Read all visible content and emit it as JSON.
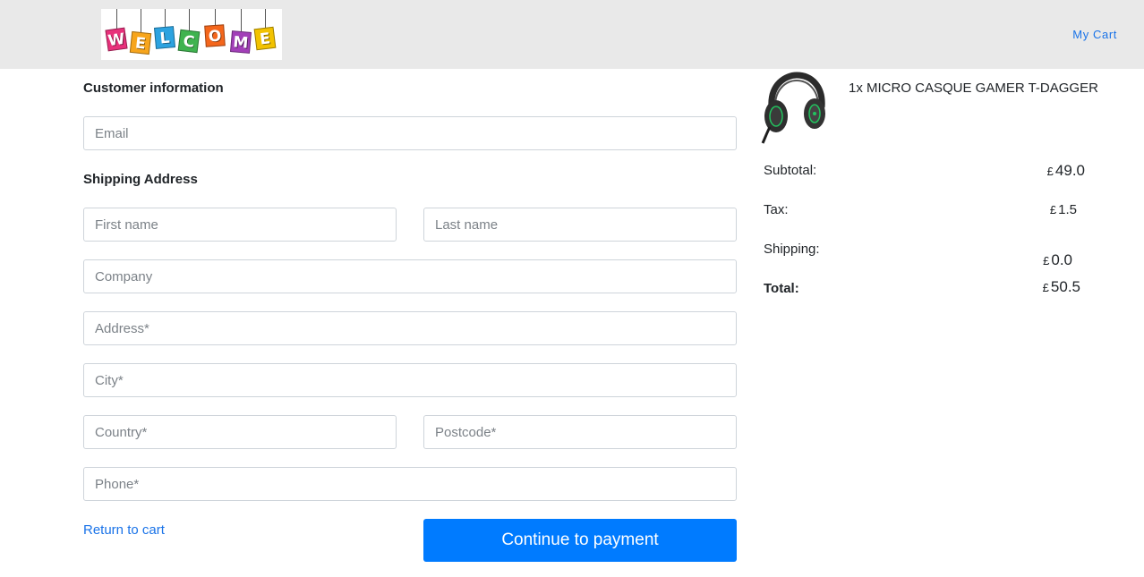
{
  "header": {
    "logo_letters": [
      "W",
      "E",
      "L",
      "C",
      "O",
      "M",
      "E"
    ],
    "logo_colors": [
      "#e8317b",
      "#f7a51c",
      "#2ca3e0",
      "#3fb34f",
      "#f4661b",
      "#a23fb8",
      "#f2c200"
    ],
    "cart_link": "My Cart"
  },
  "form": {
    "customer_title": "Customer information",
    "email_placeholder": "Email",
    "shipping_title": "Shipping Address",
    "first_name_placeholder": "First name",
    "last_name_placeholder": "Last name",
    "company_placeholder": "Company",
    "address_placeholder": "Address*",
    "city_placeholder": "City*",
    "country_placeholder": "Country*",
    "postcode_placeholder": "Postcode*",
    "phone_placeholder": "Phone*",
    "return_link": "Return to cart",
    "continue_button": "Continue to payment"
  },
  "order": {
    "item_name": "1x MICRO CASQUE GAMER T-DAGGER",
    "currency_symbol": "£",
    "subtotal_label": "Subtotal:",
    "subtotal_value": "49.0",
    "tax_label": "Tax:",
    "tax_value": "1.5",
    "shipping_label": "Shipping:",
    "shipping_value": "0.0",
    "total_label": "Total:",
    "total_value": "50.5"
  },
  "colors": {
    "accent": "#007bff",
    "link": "#1a73e8",
    "header_bg": "#e9e9e9"
  }
}
